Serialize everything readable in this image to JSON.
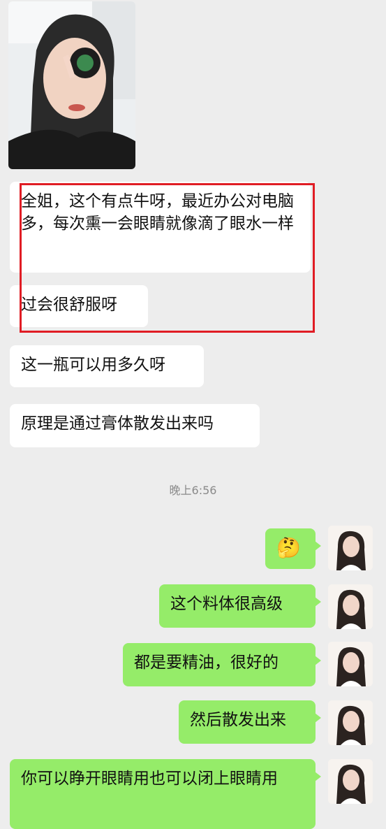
{
  "chat": {
    "timestamp": "晚上6:56",
    "incoming": [
      {
        "text": "全姐，这个有点牛呀，最近办公对电脑多，每次熏一会眼睛就像滴了眼水一样"
      },
      {
        "text": "过会很舒服呀"
      },
      {
        "text": "这一瓶可以用多久呀"
      },
      {
        "text": "原理是通过膏体散发出来吗"
      }
    ],
    "outgoing": [
      {
        "text": "🤔"
      },
      {
        "text": "这个料体很高级"
      },
      {
        "text": "都是要精油，很好的"
      },
      {
        "text": "然后散发出来"
      },
      {
        "text": "你可以睁开眼睛用也可以闭上眼睛用"
      }
    ]
  },
  "colors": {
    "background": "#ededed",
    "incoming_bubble": "#ffffff",
    "outgoing_bubble": "#95ec69",
    "highlight_border": "#e01c24"
  }
}
